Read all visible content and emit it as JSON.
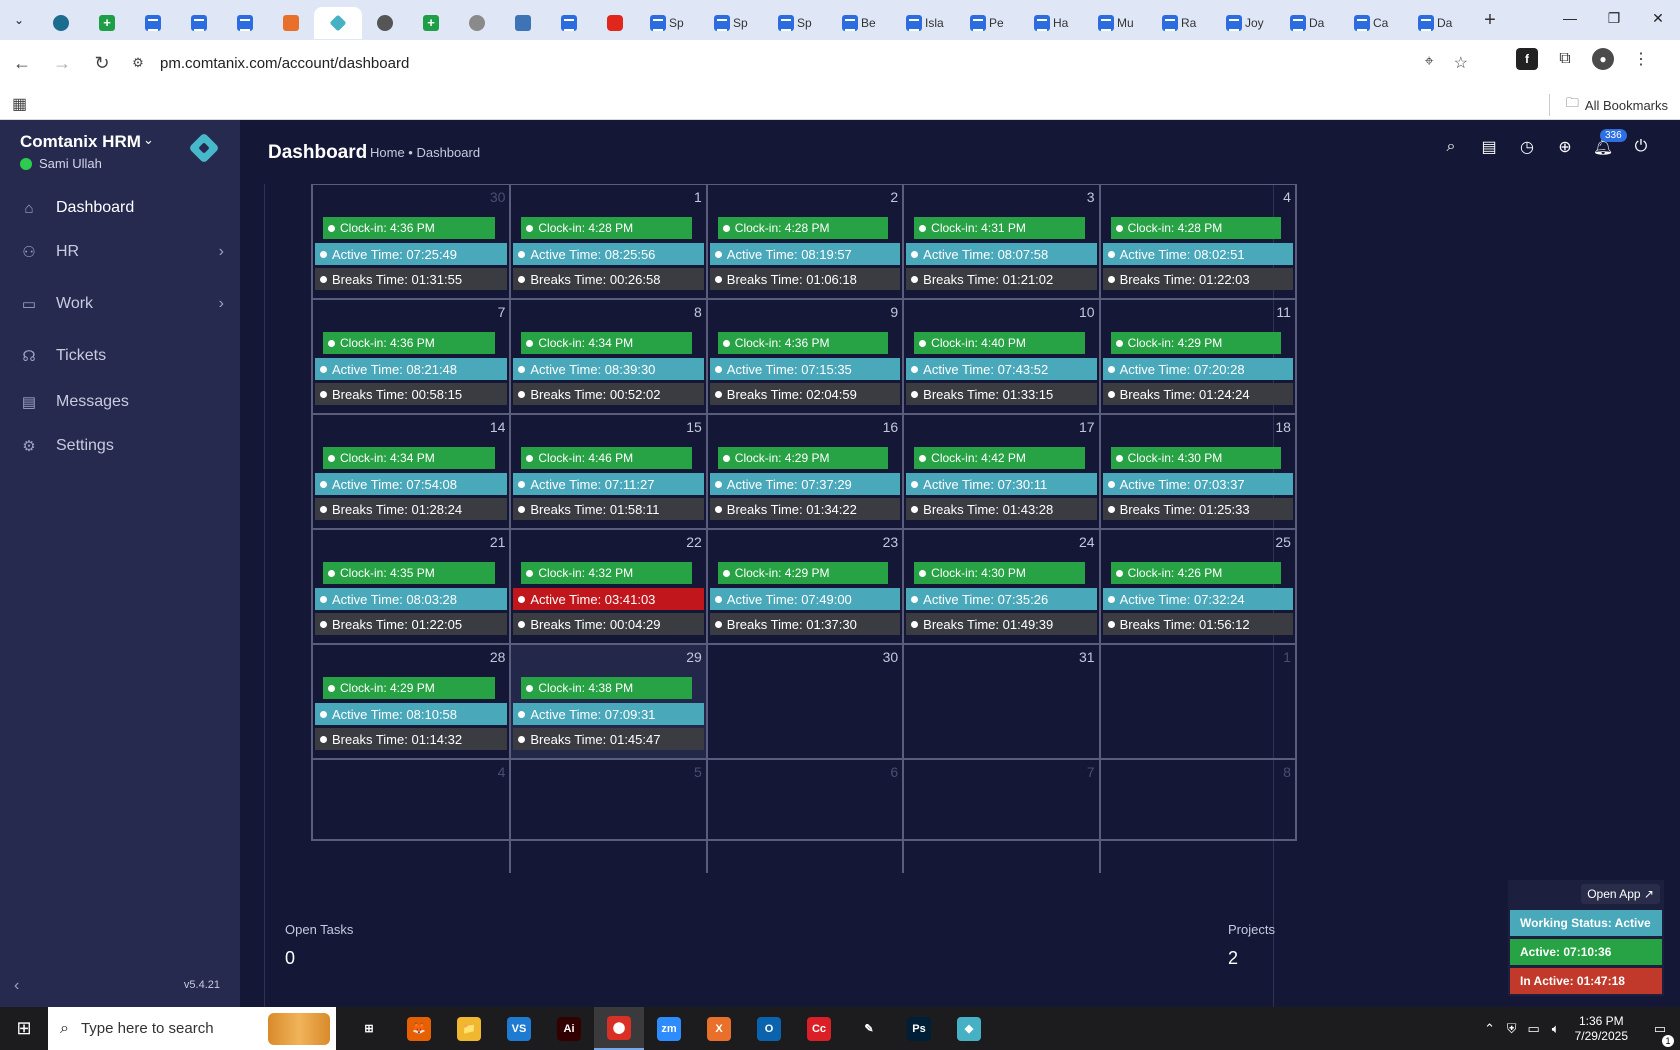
{
  "browser": {
    "tabs": [
      {
        "icon": "wordpress-icon",
        "label": ""
      },
      {
        "icon": "sheets-icon",
        "label": ""
      },
      {
        "icon": "docs-icon",
        "label": ""
      },
      {
        "icon": "docs-icon",
        "label": ""
      },
      {
        "icon": "docs-icon",
        "label": ""
      },
      {
        "icon": "xampp-icon",
        "label": ""
      },
      {
        "icon": "comtanix-icon",
        "label": "",
        "active": true
      },
      {
        "icon": "chatgpt-icon",
        "label": ""
      },
      {
        "icon": "sheets-icon",
        "label": ""
      },
      {
        "icon": "globe-icon",
        "label": ""
      },
      {
        "icon": "qr-icon",
        "label": ""
      },
      {
        "icon": "docs-icon",
        "label": ""
      },
      {
        "icon": "youtube-icon",
        "label": ""
      },
      {
        "icon": "docs-icon",
        "label": "Sp"
      },
      {
        "icon": "docs-icon",
        "label": "Sp"
      },
      {
        "icon": "docs-icon",
        "label": "Sp"
      },
      {
        "icon": "docs-icon",
        "label": "Be"
      },
      {
        "icon": "docs-icon",
        "label": "Isla"
      },
      {
        "icon": "docs-icon",
        "label": "Pe"
      },
      {
        "icon": "docs-icon",
        "label": "Ha"
      },
      {
        "icon": "docs-icon",
        "label": "Mu"
      },
      {
        "icon": "docs-icon",
        "label": "Ra"
      },
      {
        "icon": "docs-icon",
        "label": "Joy"
      },
      {
        "icon": "docs-icon",
        "label": "Da"
      },
      {
        "icon": "docs-icon",
        "label": "Ca"
      },
      {
        "icon": "docs-icon",
        "label": "Da"
      }
    ],
    "url": "pm.comtanix.com/account/dashboard",
    "bookmarks_label": "All Bookmarks"
  },
  "app": {
    "brand": "Comtanix HRM",
    "user": "Sami Ullah",
    "menu": [
      {
        "label": "Dashboard",
        "icon": "home-icon",
        "active": true,
        "chevron": false
      },
      {
        "label": "HR",
        "icon": "users-icon",
        "active": false,
        "chevron": true
      },
      {
        "label": "Work",
        "icon": "briefcase-icon",
        "active": false,
        "chevron": true
      },
      {
        "label": "Tickets",
        "icon": "headset-icon",
        "active": false,
        "chevron": false
      },
      {
        "label": "Messages",
        "icon": "message-icon",
        "active": false,
        "chevron": false
      },
      {
        "label": "Settings",
        "icon": "gear-icon",
        "active": false,
        "chevron": false
      }
    ],
    "version": "v5.4.21",
    "page_title": "Dashboard",
    "breadcrumb": "Home • Dashboard",
    "notification_count": "336"
  },
  "calendar": {
    "weeks": [
      [
        {
          "day": "30",
          "muted": true,
          "clock": "Clock-in: 4:36 PM",
          "active": "Active Time: 07:25:49",
          "breaks": "Breaks Time: 01:31:55"
        },
        {
          "day": "1",
          "clock": "Clock-in: 4:28 PM",
          "active": "Active Time: 08:25:56",
          "breaks": "Breaks Time: 00:26:58"
        },
        {
          "day": "2",
          "clock": "Clock-in: 4:28 PM",
          "active": "Active Time: 08:19:57",
          "breaks": "Breaks Time: 01:06:18"
        },
        {
          "day": "3",
          "clock": "Clock-in: 4:31 PM",
          "active": "Active Time: 08:07:58",
          "breaks": "Breaks Time: 01:21:02"
        },
        {
          "day": "4",
          "clock": "Clock-in: 4:28 PM",
          "active": "Active Time: 08:02:51",
          "breaks": "Breaks Time: 01:22:03"
        }
      ],
      [
        {
          "day": "7",
          "clock": "Clock-in: 4:36 PM",
          "active": "Active Time: 08:21:48",
          "breaks": "Breaks Time: 00:58:15"
        },
        {
          "day": "8",
          "clock": "Clock-in: 4:34 PM",
          "active": "Active Time: 08:39:30",
          "breaks": "Breaks Time: 00:52:02"
        },
        {
          "day": "9",
          "clock": "Clock-in: 4:36 PM",
          "active": "Active Time: 07:15:35",
          "breaks": "Breaks Time: 02:04:59"
        },
        {
          "day": "10",
          "clock": "Clock-in: 4:40 PM",
          "active": "Active Time: 07:43:52",
          "breaks": "Breaks Time: 01:33:15"
        },
        {
          "day": "11",
          "clock": "Clock-in: 4:29 PM",
          "active": "Active Time: 07:20:28",
          "breaks": "Breaks Time: 01:24:24"
        }
      ],
      [
        {
          "day": "14",
          "clock": "Clock-in: 4:34 PM",
          "active": "Active Time: 07:54:08",
          "breaks": "Breaks Time: 01:28:24"
        },
        {
          "day": "15",
          "clock": "Clock-in: 4:46 PM",
          "active": "Active Time: 07:11:27",
          "breaks": "Breaks Time: 01:58:11"
        },
        {
          "day": "16",
          "clock": "Clock-in: 4:29 PM",
          "active": "Active Time: 07:37:29",
          "breaks": "Breaks Time: 01:34:22"
        },
        {
          "day": "17",
          "clock": "Clock-in: 4:42 PM",
          "active": "Active Time: 07:30:11",
          "breaks": "Breaks Time: 01:43:28"
        },
        {
          "day": "18",
          "clock": "Clock-in: 4:30 PM",
          "active": "Active Time: 07:03:37",
          "breaks": "Breaks Time: 01:25:33"
        }
      ],
      [
        {
          "day": "21",
          "clock": "Clock-in: 4:35 PM",
          "active": "Active Time: 08:03:28",
          "breaks": "Breaks Time: 01:22:05"
        },
        {
          "day": "22",
          "clock": "Clock-in: 4:32 PM",
          "active": "Active Time: 03:41:03",
          "breaks": "Breaks Time: 00:04:29",
          "late": true
        },
        {
          "day": "23",
          "clock": "Clock-in: 4:29 PM",
          "active": "Active Time: 07:49:00",
          "breaks": "Breaks Time: 01:37:30"
        },
        {
          "day": "24",
          "clock": "Clock-in: 4:30 PM",
          "active": "Active Time: 07:35:26",
          "breaks": "Breaks Time: 01:49:39"
        },
        {
          "day": "25",
          "clock": "Clock-in: 4:26 PM",
          "active": "Active Time: 07:32:24",
          "breaks": "Breaks Time: 01:56:12"
        }
      ],
      [
        {
          "day": "28",
          "clock": "Clock-in: 4:29 PM",
          "active": "Active Time: 08:10:58",
          "breaks": "Breaks Time: 01:14:32"
        },
        {
          "day": "29",
          "today": true,
          "clock": "Clock-in: 4:38 PM",
          "active": "Active Time: 07:09:31",
          "breaks": "Breaks Time: 01:45:47"
        },
        {
          "day": "30"
        },
        {
          "day": "31"
        },
        {
          "day": "1",
          "muted": true
        }
      ],
      [
        {
          "day": "4",
          "muted": true
        },
        {
          "day": "5",
          "muted": true
        },
        {
          "day": "6",
          "muted": true
        },
        {
          "day": "7",
          "muted": true
        },
        {
          "day": "8",
          "muted": true
        }
      ]
    ]
  },
  "stats": {
    "open_tasks_label": "Open Tasks",
    "open_tasks_value": "0",
    "projects_label": "Projects",
    "projects_value": "2"
  },
  "widget": {
    "open_app": "Open App ↗",
    "status": "Working Status: Active",
    "active": "Active: 07:10:36",
    "inactive": "In Active: 01:47:18"
  },
  "taskbar": {
    "search_placeholder": "Type here to search",
    "time": "1:36 PM",
    "date": "7/29/2025",
    "notification_count": "1",
    "apps": [
      {
        "name": "task-view",
        "label": "⊞",
        "color": "#1c1c1e"
      },
      {
        "name": "firefox",
        "label": "🦊",
        "color": "#e66000"
      },
      {
        "name": "file-explorer",
        "label": "📁",
        "color": "#f2b731"
      },
      {
        "name": "vscode",
        "label": "VS",
        "color": "#1f7ad1"
      },
      {
        "name": "illustrator",
        "label": "Ai",
        "color": "#330000"
      },
      {
        "name": "chrome",
        "label": "⬤",
        "color": "#d93025"
      },
      {
        "name": "zoom",
        "label": "zm",
        "color": "#2d8cff"
      },
      {
        "name": "xampp",
        "label": "X",
        "color": "#e8702a"
      },
      {
        "name": "outlook",
        "label": "O",
        "color": "#0a64ad"
      },
      {
        "name": "creative-cloud",
        "label": "Cc",
        "color": "#da1f26"
      },
      {
        "name": "pen-tool",
        "label": "✎",
        "color": "#1c1c1e"
      },
      {
        "name": "photoshop",
        "label": "Ps",
        "color": "#001e36"
      },
      {
        "name": "comtanix",
        "label": "◆",
        "color": "#46b1c5"
      }
    ]
  }
}
